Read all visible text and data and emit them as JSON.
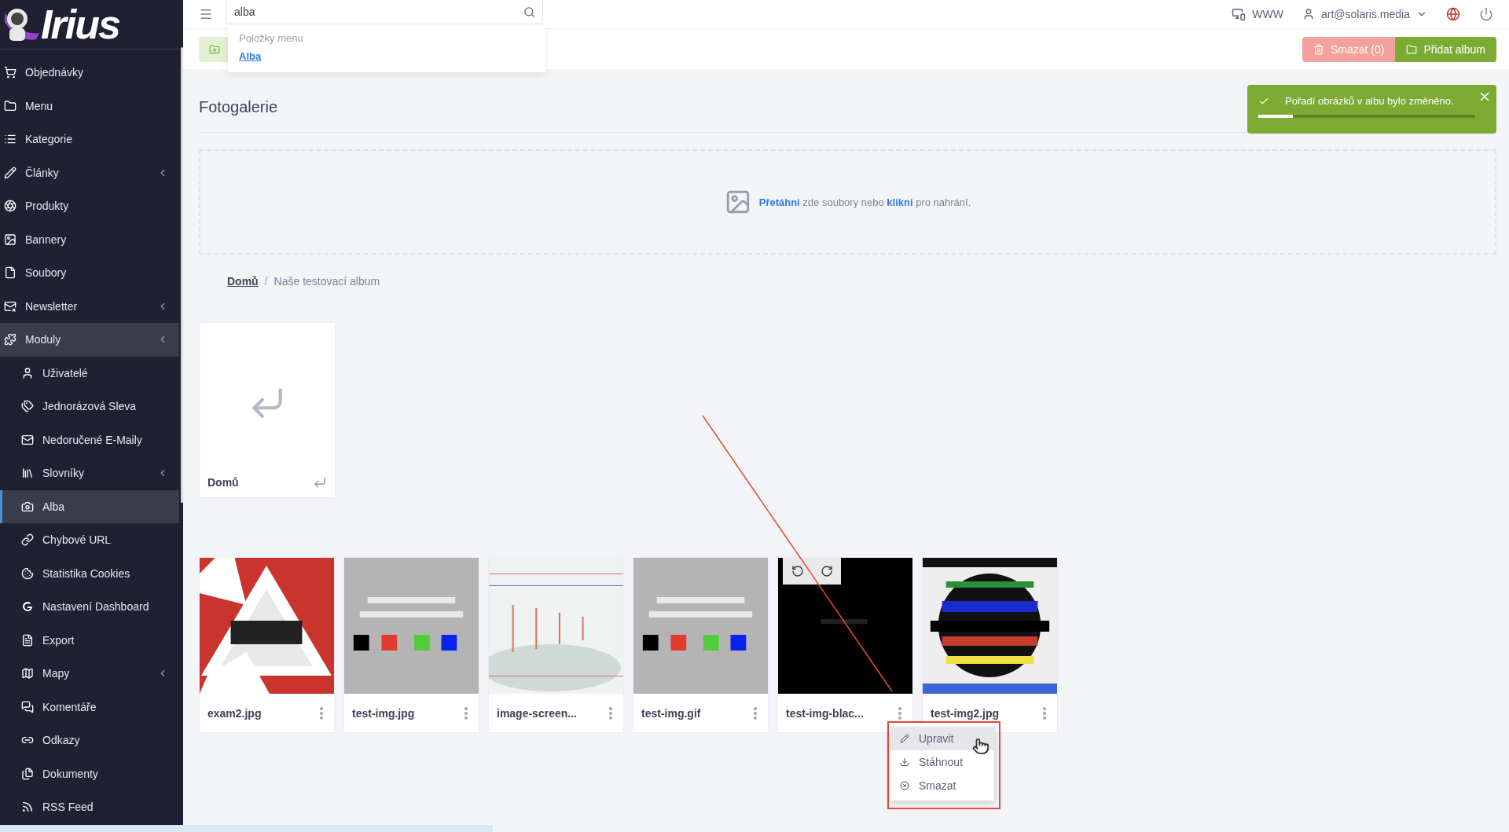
{
  "logo": {
    "text": "Irius"
  },
  "sidebar": {
    "items": [
      {
        "label": "Objednávky",
        "expandable": false,
        "expanded": false,
        "selected": false
      },
      {
        "label": "Menu",
        "expandable": false,
        "expanded": false,
        "selected": false
      },
      {
        "label": "Kategorie",
        "expandable": false,
        "expanded": false,
        "selected": false
      },
      {
        "label": "Články",
        "expandable": true,
        "expanded": false,
        "selected": false
      },
      {
        "label": "Produkty",
        "expandable": false,
        "expanded": false,
        "selected": false
      },
      {
        "label": "Bannery",
        "expandable": false,
        "expanded": false,
        "selected": false
      },
      {
        "label": "Soubory",
        "expandable": false,
        "expanded": false,
        "selected": false
      },
      {
        "label": "Newsletter",
        "expandable": true,
        "expanded": false,
        "selected": false
      },
      {
        "label": "Moduly",
        "expandable": true,
        "expanded": true,
        "selected": false,
        "children": [
          {
            "label": "Uživatelé",
            "expandable": false,
            "selected": false
          },
          {
            "label": "Jednorázová Sleva",
            "expandable": false,
            "selected": false
          },
          {
            "label": "Nedoručené E-Maily",
            "expandable": false,
            "selected": false
          },
          {
            "label": "Slovníky",
            "expandable": true,
            "selected": false
          },
          {
            "label": "Alba",
            "expandable": false,
            "selected": true
          },
          {
            "label": "Chybové URL",
            "expandable": false,
            "selected": false
          },
          {
            "label": "Statistika Cookies",
            "expandable": false,
            "selected": false
          },
          {
            "label": "Nastavení Dashboard",
            "expandable": false,
            "selected": false
          },
          {
            "label": "Export",
            "expandable": false,
            "selected": false
          },
          {
            "label": "Mapy",
            "expandable": true,
            "selected": false
          },
          {
            "label": "Komentáře",
            "expandable": false,
            "selected": false
          },
          {
            "label": "Odkazy",
            "expandable": false,
            "selected": false
          },
          {
            "label": "Dokumenty",
            "expandable": false,
            "selected": false
          },
          {
            "label": "RSS Feed",
            "expandable": false,
            "selected": false
          }
        ]
      }
    ]
  },
  "topbar": {
    "search": {
      "value": "alba"
    },
    "search_results": {
      "heading": "Položky menu",
      "items": [
        "Alba"
      ]
    },
    "www": "WWW",
    "user": "art@solaris.media"
  },
  "actions": {
    "buttons": [
      {
        "label": "Smazat (0)",
        "kind": "danger",
        "disabled": true
      },
      {
        "label": "Přidat album",
        "kind": "success",
        "disabled": false
      }
    ]
  },
  "toast": {
    "message": "Pořadí obrázků v albu bylo změněno.",
    "level": 0.16
  },
  "page": {
    "title": "Fotogalerie",
    "dropzone": "**Přetáhni** zde soubory nebo **klikni** pro nahrání.",
    "breadcrumb": {
      "separator": "/",
      "items": [
        {
          "label": "Domů",
          "link": true
        },
        {
          "label": "Naše testovací album",
          "link": false
        }
      ]
    },
    "folder": {
      "label": "Domů"
    },
    "images": [
      {
        "name": "exam2.jpg",
        "hovered": false,
        "menu_open": false
      },
      {
        "name": "test-img.jpg",
        "hovered": false,
        "menu_open": false
      },
      {
        "name": "image-screen...",
        "hovered": false,
        "menu_open": false
      },
      {
        "name": "test-img.gif",
        "hovered": false,
        "menu_open": false
      },
      {
        "name": "test-img-blac...",
        "hovered": true,
        "menu_open": true
      },
      {
        "name": "test-img2.jpg",
        "hovered": false,
        "menu_open": false
      }
    ],
    "context_menu": {
      "items": [
        {
          "label": "Upravit",
          "highlighted": true
        },
        {
          "label": "Stáhnout",
          "highlighted": false
        },
        {
          "label": "Smazat",
          "highlighted": false
        }
      ]
    }
  }
}
